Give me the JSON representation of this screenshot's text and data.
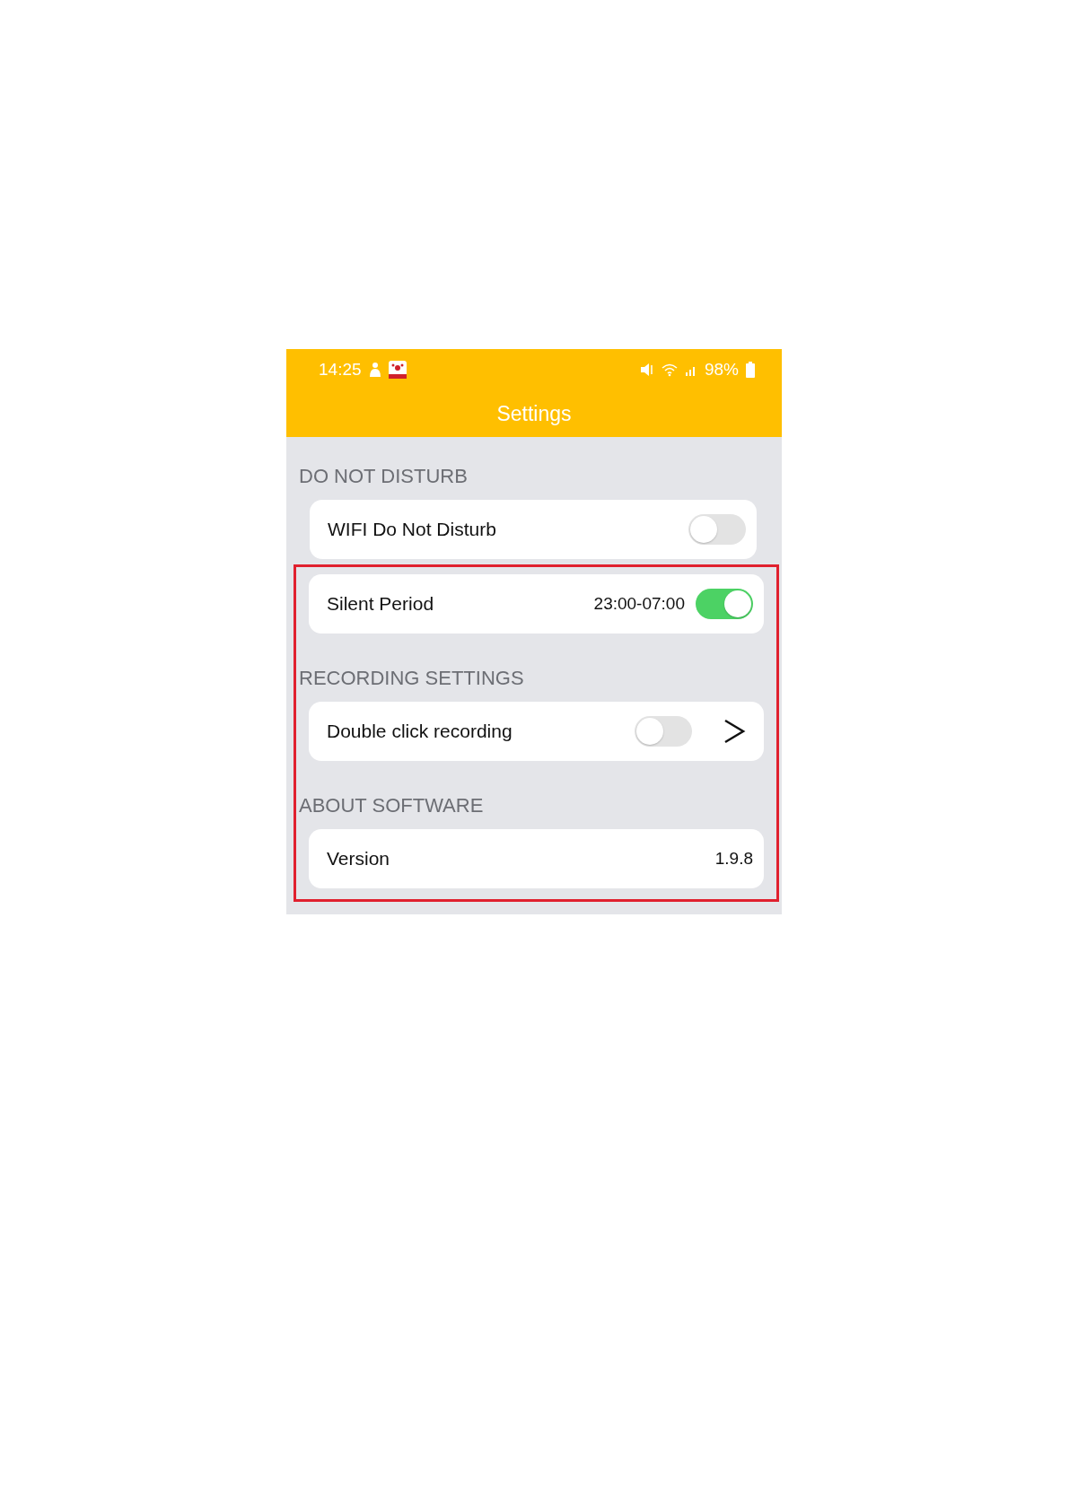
{
  "status_bar": {
    "time": "14:25",
    "battery": "98%"
  },
  "title": "Settings",
  "items": [
    {
      "kind": "header",
      "text": "DO NOT DISTURB"
    },
    {
      "kind": "row",
      "label": "WIFI Do Not Disturb",
      "switch_on": false
    }
  ],
  "highlight_frame": {
    "items": [
      {
        "kind": "row",
        "label": "Silent Period",
        "value": "23:00-07:00",
        "switch_on": true
      },
      {
        "kind": "header",
        "text": "RECORDING SETTINGS"
      },
      {
        "kind": "row",
        "label": "Double click recording",
        "switch_on": false,
        "arrow": true
      },
      {
        "kind": "header",
        "text": "ABOUT SOFTWARE"
      },
      {
        "kind": "row",
        "label": "Version",
        "value": "1.9.8"
      }
    ]
  }
}
